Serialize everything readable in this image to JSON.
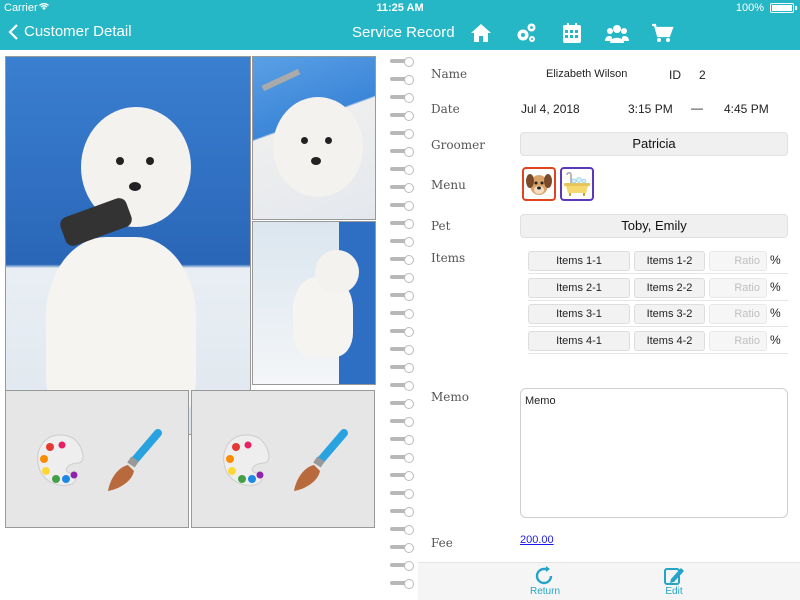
{
  "status_bar": {
    "carrier": "Carrier",
    "time": "11:25 AM",
    "battery": "100%"
  },
  "nav": {
    "back_label": "Customer Detail",
    "title": "Service Record",
    "icons": [
      "home-icon",
      "settings-gears-icon",
      "calendar-icon",
      "users-group-icon",
      "cart-icon"
    ]
  },
  "photos": {
    "art_buttons": [
      "palette-icon",
      "paint-brush-icon"
    ]
  },
  "form": {
    "name_label": "Name",
    "name_value": "Elizabeth Wilson",
    "id_label": "ID",
    "id_value": "2",
    "date_label": "Date",
    "date_value": "Jul 4, 2018",
    "start_time": "3:15 PM",
    "dash": "—",
    "end_time": "4:45 PM",
    "groomer_label": "Groomer",
    "groomer_value": "Patricia",
    "menu_label": "Menu",
    "menu_icons": [
      "dog-face-icon",
      "bathtub-icon"
    ],
    "pet_label": "Pet",
    "pet_value": "Toby, Emily",
    "items_label": "Items",
    "items": [
      {
        "a": "Items 1-1",
        "b": "Items 1-2",
        "ratio_placeholder": "Ratio",
        "pct": "%"
      },
      {
        "a": "Items 2-1",
        "b": "Items 2-2",
        "ratio_placeholder": "Ratio",
        "pct": "%"
      },
      {
        "a": "Items 3-1",
        "b": "Items 3-2",
        "ratio_placeholder": "Ratio",
        "pct": "%"
      },
      {
        "a": "Items 4-1",
        "b": "Items 4-2",
        "ratio_placeholder": "Ratio",
        "pct": "%"
      }
    ],
    "memo_label": "Memo",
    "memo_value": "Memo",
    "fee_label": "Fee",
    "fee_value": "200.00"
  },
  "bottom": {
    "return_label": "Return",
    "edit_label": "Edit"
  },
  "colors": {
    "accent": "#25b7c6",
    "link": "#1a1aee",
    "tab_tint": "#25a4c8"
  }
}
